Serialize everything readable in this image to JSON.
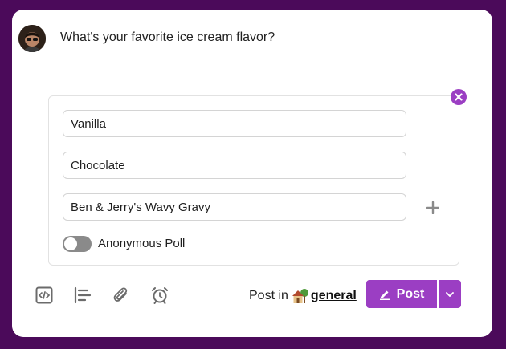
{
  "composer": {
    "question": "What's your favorite ice cream flavor?"
  },
  "poll": {
    "options": [
      "Vanilla",
      "Chocolate",
      "Ben & Jerry's Wavy Gravy"
    ],
    "anonymous_label": "Anonymous Poll",
    "anonymous_enabled": false
  },
  "toolbar": {
    "icons": [
      "code-block-icon",
      "poll-list-icon",
      "paperclip-icon",
      "alarm-clock-icon"
    ]
  },
  "footer": {
    "post_in_label": "Post in",
    "channel_name": "general",
    "channel_icon": "house-with-tree-emoji",
    "post_label": "Post"
  },
  "colors": {
    "accent": "#9b3ec3",
    "background": "#4b0a5a"
  }
}
